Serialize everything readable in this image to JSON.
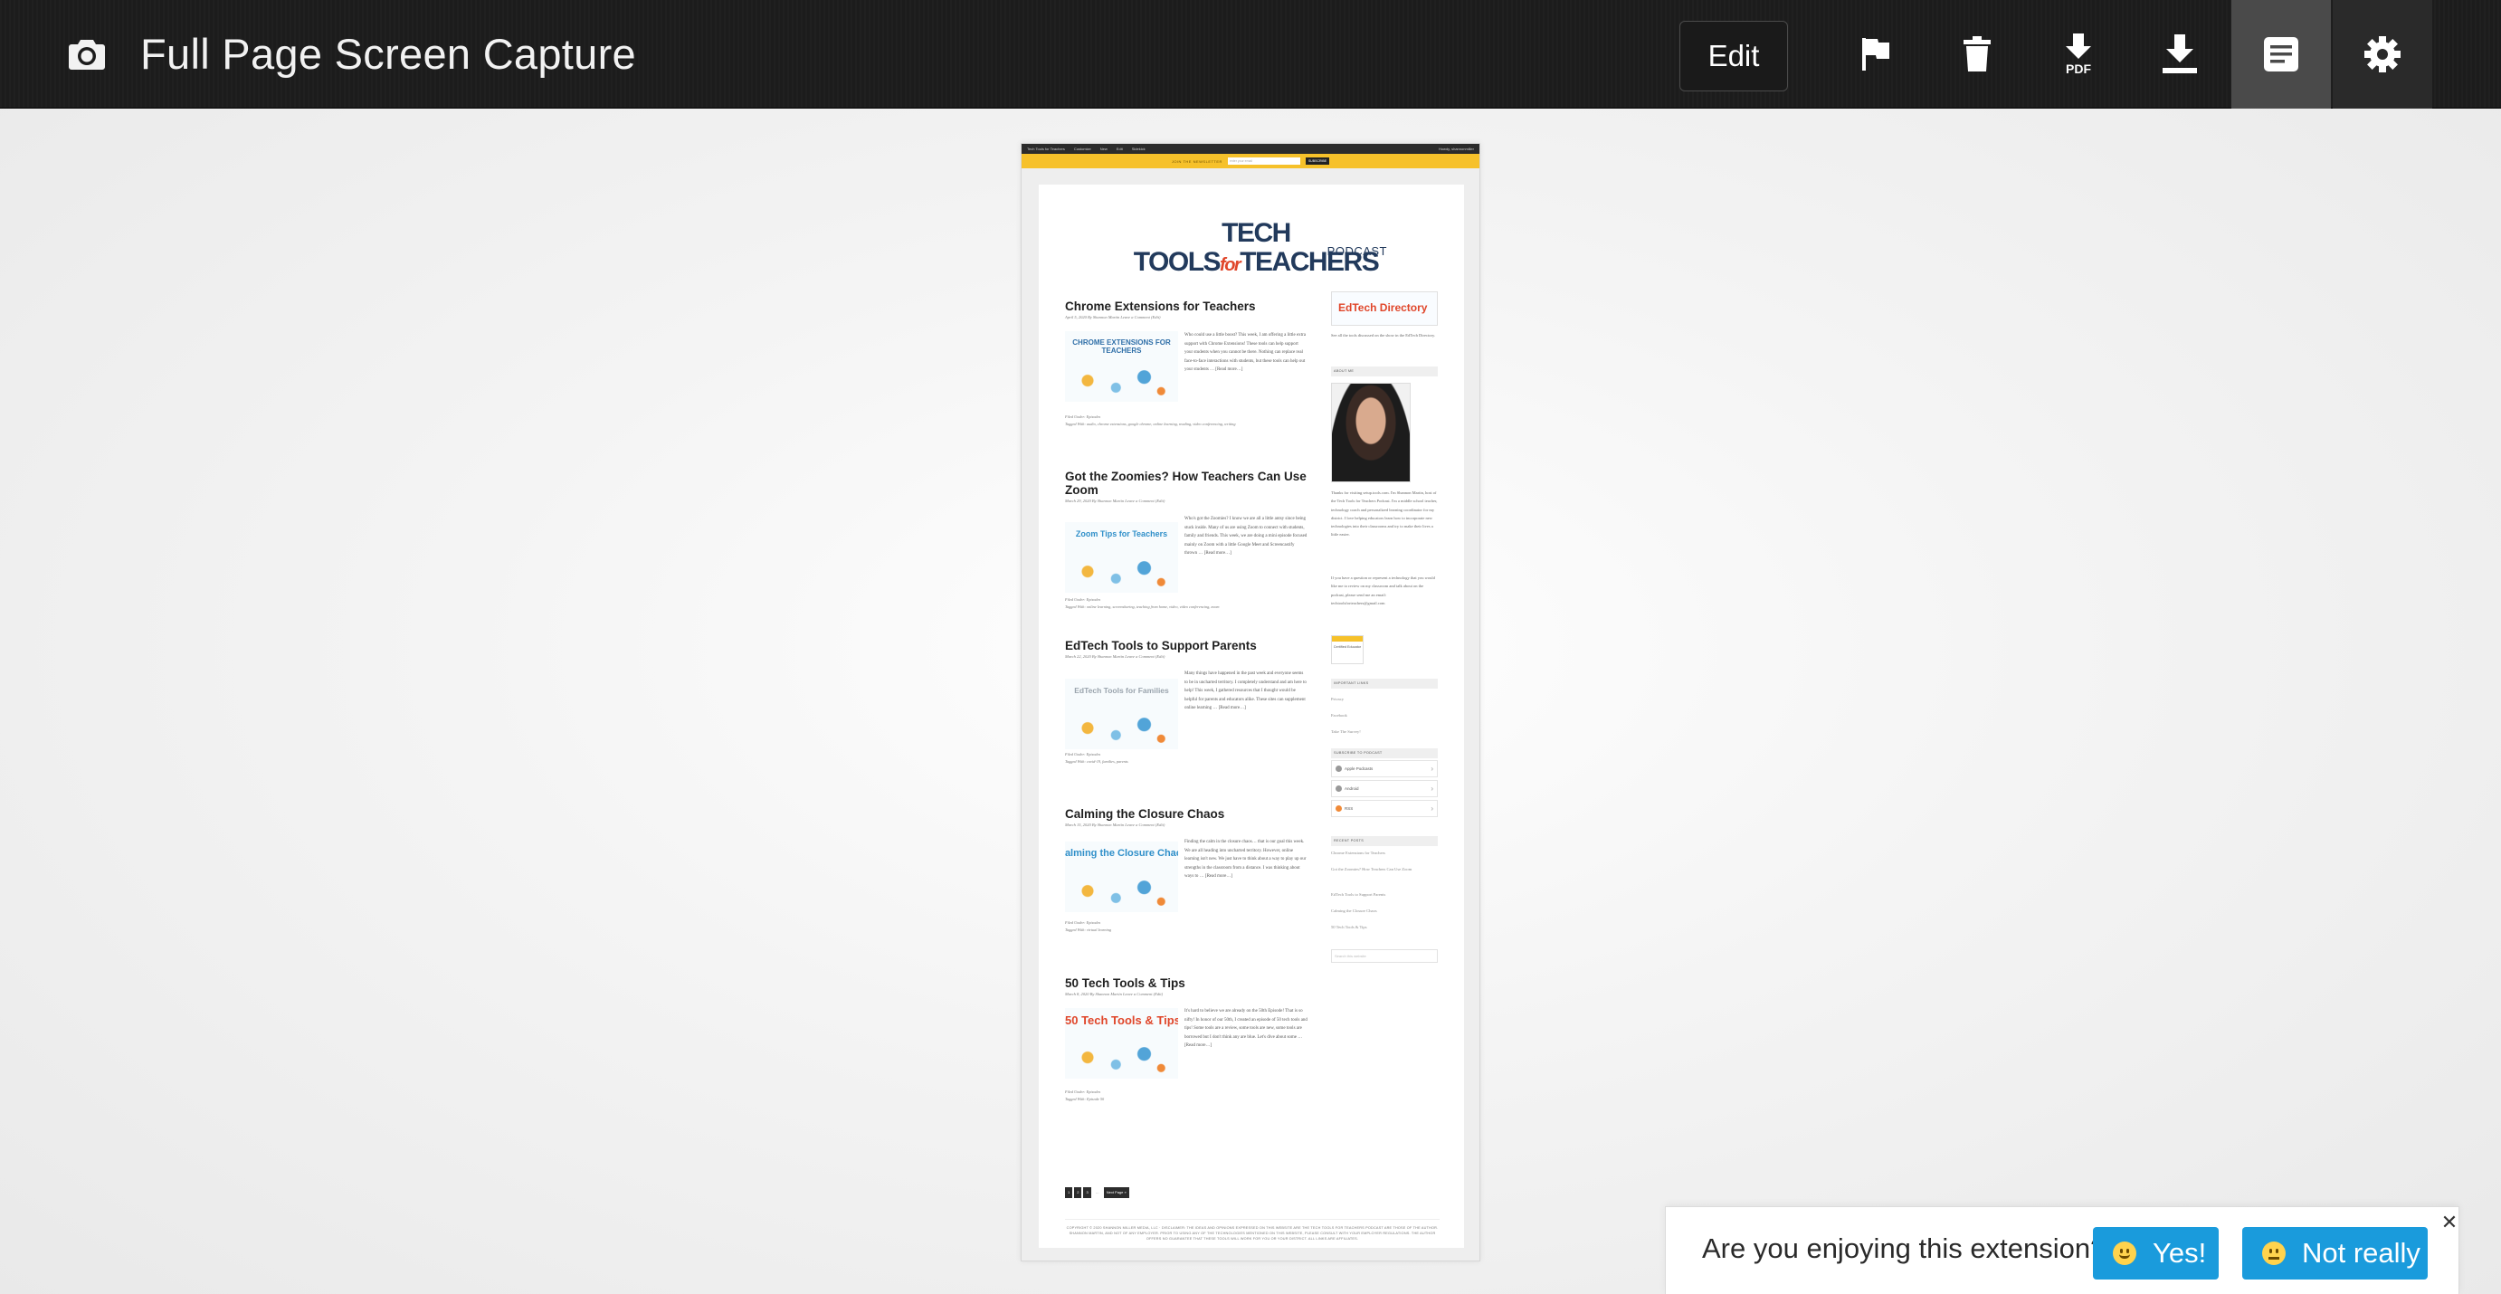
{
  "toolbar": {
    "title": "Full Page Screen Capture",
    "edit_label": "Edit",
    "icons": [
      "camera-icon",
      "flag-icon",
      "trash-icon",
      "pdf-download-icon",
      "download-icon",
      "document-icon",
      "gear-icon"
    ],
    "pdf_label": "PDF"
  },
  "capture": {
    "admin_bar": {
      "items": [
        "Tech Tools for Teachers",
        "Customize",
        "New",
        "Edit",
        "Sidekick"
      ],
      "user": "Howdy, shannonmiller"
    },
    "top_bar": {
      "text": "JOIN THE NEWSLETTER",
      "placeholder": "enter your email",
      "button": "SUBSCRIBE"
    },
    "logo": {
      "line1_a": "TECH TOOLS",
      "line1_for": "for",
      "line1_b": "TEACHERS",
      "line2": "PODCAST"
    },
    "posts": [
      {
        "title": "Chrome Extensions for Teachers",
        "meta": "April 5, 2020 By Shannon Martin Leave a Comment (Edit)",
        "thumb": "CHROME EXTENSIONS FOR TEACHERS",
        "excerpt": "Who could use a little boost? This week, I am offering a little extra support with Chrome Extensions! These tools can help support your students when you cannot be there. Nothing can replace real face-to-face interactions with students, but these tools can help out your students … [Read more…]",
        "filed": "Filed Under: Episodes",
        "tags": "Tagged With: audio, chrome extensions, google chrome, online learning, reading, video conferencing, writing"
      },
      {
        "title": "Got the Zoomies? How Teachers Can Use Zoom",
        "meta": "March 29, 2020 By Shannon Martin Leave a Comment (Edit)",
        "thumb": "Zoom Tips for Teachers",
        "excerpt": "Who's got the Zoomies? I know we are all a little antsy since being stuck inside. Many of us are using Zoom to connect with students, family and friends. This week, we are doing a mini episode focused mainly on Zoom with a little Google Meet and Screencastify thrown … [Read more…]",
        "filed": "Filed Under: Episodes",
        "tags": "Tagged With: online learning, screensharing, teaching from home, video, video conferencing, zoom"
      },
      {
        "title": "EdTech Tools to Support Parents",
        "meta": "March 22, 2020 By Shannon Martin Leave a Comment (Edit)",
        "thumb": "EdTech Tools for Families",
        "excerpt": "Many things have happened in the past week and everyone seems to be in uncharted territory. I completely understand and am here to help! This week, I gathered resources that I thought would be helpful for parents and educators alike. These sites can supplement online learning … [Read more…]",
        "filed": "Filed Under: Episodes",
        "tags": "Tagged With: covid-19, families, parents"
      },
      {
        "title": "Calming the Closure Chaos",
        "meta": "March 15, 2020 By Shannon Martin Leave a Comment (Edit)",
        "thumb": "Calming the Closure Chaos",
        "excerpt": "Finding the calm in the closure chaos… that is our goal this week. We are all heading into uncharted territory. However, online learning isn't new. We just have to think about a way to play up our strengths in the classroom from a distance. I was thinking about ways to … [Read more…]",
        "filed": "Filed Under: Episodes",
        "tags": "Tagged With: virtual learning"
      },
      {
        "title": "50 Tech Tools & Tips",
        "meta": "March 8, 2020 By Shannon Martin Leave a Comment (Edit)",
        "thumb": "50 Tech Tools & Tips",
        "excerpt": "It's hard to believe we are already on the 50th Episode! That is so nifty! In honor of our 50th, I created an episode of 50 tech tools and tips! Some tools are a review, some tools are new, some tools are borrowed but I don't think any are blue. Let's dive about some … [Read more…]",
        "filed": "Filed Under: Episodes",
        "tags": "Tagged With: Episode 50"
      }
    ],
    "pager": [
      "1",
      "2",
      "3",
      "…",
      "Next Page »"
    ],
    "footer": "COPYRIGHT © 2020 SHANNON MILLER MEDIA, LLC · DISCLAIMER: THE IDEAS AND OPINIONS EXPRESSED ON THIS WEBSITE ARE THE TECH TOOLS FOR TEACHERS PODCAST ARE THOSE OF THE AUTHOR. SHANNON MARTIN, AND NOT OF ANY EMPLOYER. PRIOR TO USING ANY OF THE TECHNOLOGIES MENTIONED ON THIS WEBSITE, PLEASE CONSULT WITH YOUR EMPLOYER REGULATIONS. THE AUTHOR OFFERS NO GUARANTEE THAT THESE TOOLS WILL WORK FOR YOU OR YOUR DISTRICT. ALL LINKS ARE AFFILIATES.",
    "sidebar": {
      "directory_banner": "EdTech Directory",
      "directory_text": "See all the tools discussed on the show in the EdTech Directory.",
      "about_heading": "ABOUT ME",
      "about_text": "Thanks for visiting setup.tools.com. I'm Shannon Martin, host of the Tech Tools for Teachers Podcast. I'm a middle school teacher, technology coach and personalized learning coordinator for my district. I love helping educators learn how to incorporate new technologies into their classrooms and try to make their lives a little easier.",
      "contact_text": "If you have a question or represent a technology that you would like me to review on my classroom and talk about on the podcast, please send me an email: techtoolsforteachers@gmail.com",
      "badge": "Certified Educator",
      "links_heading": "IMPORTANT LINKS",
      "links": [
        "Privacy",
        "Facebook",
        "Take The Survey!"
      ],
      "subscribe_heading": "SUBSCRIBE TO PODCAST",
      "subscribe": [
        "Apple Podcasts",
        "Android",
        "RSS"
      ],
      "recent_heading": "RECENT POSTS",
      "recent": [
        "Chrome Extensions for Teachers",
        "Got the Zoomies? How Teachers Can Use Zoom",
        "EdTech Tools to Support Parents",
        "Calming the Closure Chaos",
        "50 Tech Tools & Tips"
      ],
      "search_placeholder": "Search this website"
    }
  },
  "feedback": {
    "question": "Are you enjoying this extension?",
    "yes_label": "Yes!",
    "no_label": "Not really",
    "close": "✕"
  }
}
